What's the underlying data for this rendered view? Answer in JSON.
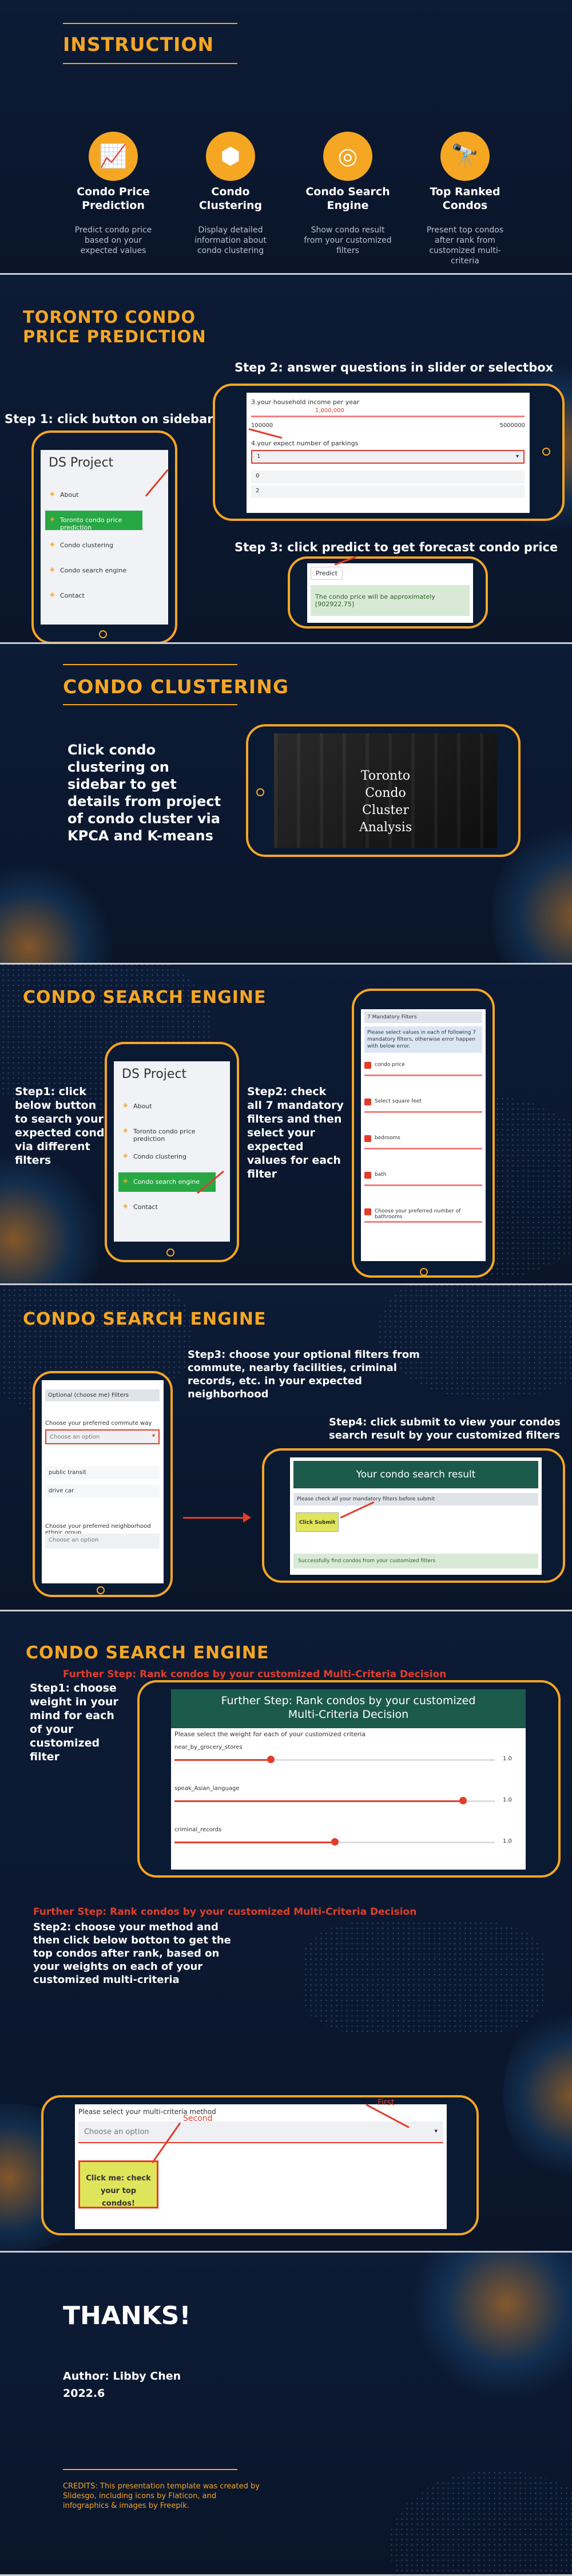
{
  "instruction": {
    "title": "INSTRUCTION",
    "cards": [
      {
        "icon": "chart-icon",
        "title": "Condo Price Prediction",
        "desc": "Predict condo price based on your expected values"
      },
      {
        "icon": "hexagon-icon",
        "title": "Condo Clustering",
        "desc": "Display detailed information about condo clustering"
      },
      {
        "icon": "target-icon",
        "title": "Condo Search Engine",
        "desc": "Show condo result from your customized filters"
      },
      {
        "icon": "telescope-icon",
        "title": "Top Ranked Condos",
        "desc": "Present top condos after rank from customized multi-criteria"
      }
    ]
  },
  "prediction": {
    "title": "TORONTO CONDO PRICE PREDICTION",
    "step1": "Step 1: click button on sidebar",
    "step2": "Step 2: answer questions in slider or selectbox",
    "step3": "Step 3: click predict to get forecast condo price",
    "sidebar": [
      "DS Project",
      "About",
      "Toronto condo price prediction",
      "Condo clustering",
      "Condo search engine",
      "Contact"
    ],
    "q1": "3.your household income per year",
    "q1a": "100000",
    "q1b": "5000000",
    "q1v": "1,000,000",
    "q2": "4.your expect number of parkings",
    "q2v": "1",
    "predict": "Predict",
    "result": "The condo price will be approximately [902922.75]"
  },
  "clustering": {
    "title": "CONDO CLUSTERING",
    "desc": "Click condo clustering on sidebar to get details from project of condo cluster via KPCA and K-means",
    "image_text": "Toronto Condo Cluster Analysis"
  },
  "search": {
    "title": "CONDO SEARCH ENGINE",
    "step1": "Step1: click below button to search your expected condo via different filters",
    "step2": "Step2: check all 7 mandatory filters and then select your expected values for each filter",
    "sidebar": [
      "DS Project",
      "About",
      "Toronto condo price prediction",
      "Condo clustering",
      "Condo search engine",
      "Contact"
    ],
    "mand": "7 Mandatory Filters",
    "mand_note": "Please select values in each of following 7 mandatory filters, otherwise error happen with below error.",
    "filters": [
      "condo price",
      "Select square feet",
      "bedrooms",
      "bath",
      "Choose your preferred number of bathrooms"
    ]
  },
  "search2": {
    "title": "CONDO SEARCH ENGINE",
    "step3": "Step3: choose your optional filters from commute, nearby facilities, criminal records, etc. in your expected neighborhood",
    "step4": "Step4: click submit to view your condos search result by your customized filters",
    "opt": "Optional (choose me) Filters",
    "q1": "Choose your preferred commute way",
    "opt_ph": "Choose an option",
    "opt1": "public transit",
    "opt2": "drive car",
    "q2": "Choose your preferred neighborhood ethnic group",
    "result_title": "Your condo search result",
    "check": "Please check all your mandatory filters before submit",
    "submit": "Click Submit",
    "success": "Successfully find condos from your customized filters"
  },
  "mcdm": {
    "title": "CONDO SEARCH ENGINE",
    "subtitle": "Further Step: Rank condos by your customized Multi-Criteria Decision",
    "step1": "Step1: choose weight in your mind for each of your customized filter",
    "panel_title": "Further Step: Rank condos by your customized Multi-Criteria Decision",
    "weights_label": "Please select the weight for each of your customized criteria",
    "criteria": [
      {
        "name": "near_by_grocery_stores",
        "value": 0.3
      },
      {
        "name": "speak_Asian_language",
        "value": 0.9
      },
      {
        "name": "criminal_records",
        "value": 0.5
      }
    ],
    "max": "1.0",
    "subtitle2": "Further Step: Rank condos by your customized Multi-Criteria Decision",
    "step2": "Step2: choose your method and then click below botton to get the top condos after rank, based on your weights on each of your customized multi-criteria",
    "method_label": "Please select your multi-criteria method",
    "method_ph": "Choose an option",
    "first": "First",
    "second": "Second",
    "check_btn": "Click me: check your top condos!"
  },
  "thanks": {
    "title": "THANKS!",
    "author": "Author: Libby Chen",
    "date": "2022.6",
    "credits": "CREDITS: This presentation template was created by Slidesgo, including icons by Flaticon, and infographics & images by Freepik."
  }
}
